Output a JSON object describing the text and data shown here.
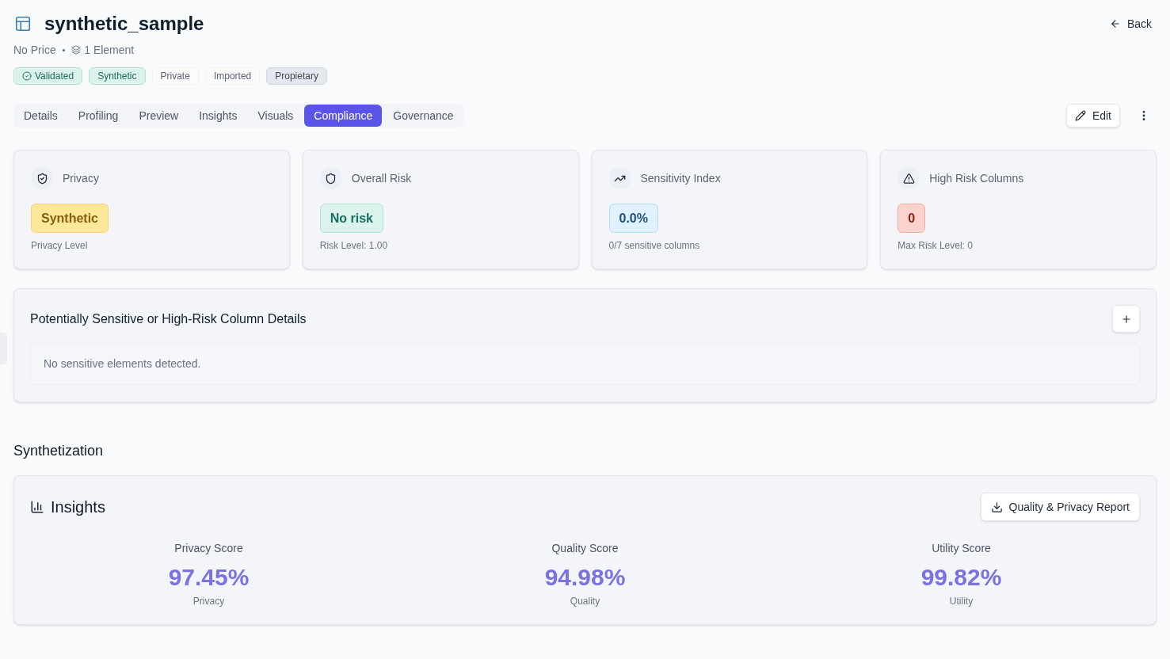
{
  "header": {
    "title": "synthetic_sample",
    "price": "No Price",
    "separator": "•",
    "elements": "1 Element",
    "back": "Back"
  },
  "badges": [
    {
      "label": "Validated",
      "kind": "verified"
    },
    {
      "label": "Synthetic",
      "kind": "teal"
    },
    {
      "label": "Private",
      "kind": "plain"
    },
    {
      "label": "Imported",
      "kind": "plain"
    },
    {
      "label": "Propietary",
      "kind": "gray"
    }
  ],
  "tabs": [
    {
      "label": "Details",
      "selected": false
    },
    {
      "label": "Profiling",
      "selected": false
    },
    {
      "label": "Preview",
      "selected": false
    },
    {
      "label": "Insights",
      "selected": false
    },
    {
      "label": "Visuals",
      "selected": false
    },
    {
      "label": "Compliance",
      "selected": true
    },
    {
      "label": "Governance",
      "selected": false
    }
  ],
  "actions": {
    "edit": "Edit"
  },
  "metric_cards": [
    {
      "kind": "privacy",
      "title": "Privacy",
      "value": "Synthetic",
      "caption": "Privacy Level"
    },
    {
      "kind": "risk",
      "title": "Overall Risk",
      "value": "No risk",
      "caption": "Risk Level: 1.00"
    },
    {
      "kind": "sensitivity",
      "title": "Sensitivity Index",
      "value": "0.0%",
      "caption": "0/7 sensitive columns"
    },
    {
      "kind": "columns",
      "title": "High Risk Columns",
      "value": "0",
      "caption": "Max Risk Level: 0"
    }
  ],
  "column_details": {
    "title": "Potentially Sensitive or High-Risk Column Details",
    "message": "No sensitive elements detected."
  },
  "synthetization": {
    "heading": "Synthetization",
    "insights": {
      "title": "Insights",
      "report_button": "Quality & Privacy Report",
      "scores": [
        {
          "label": "Privacy Score",
          "value": "97.45%",
          "caption": "Privacy"
        },
        {
          "label": "Quality Score",
          "value": "94.98%",
          "caption": "Quality"
        },
        {
          "label": "Utility Score",
          "value": "99.82%",
          "caption": "Utility"
        }
      ]
    }
  }
}
